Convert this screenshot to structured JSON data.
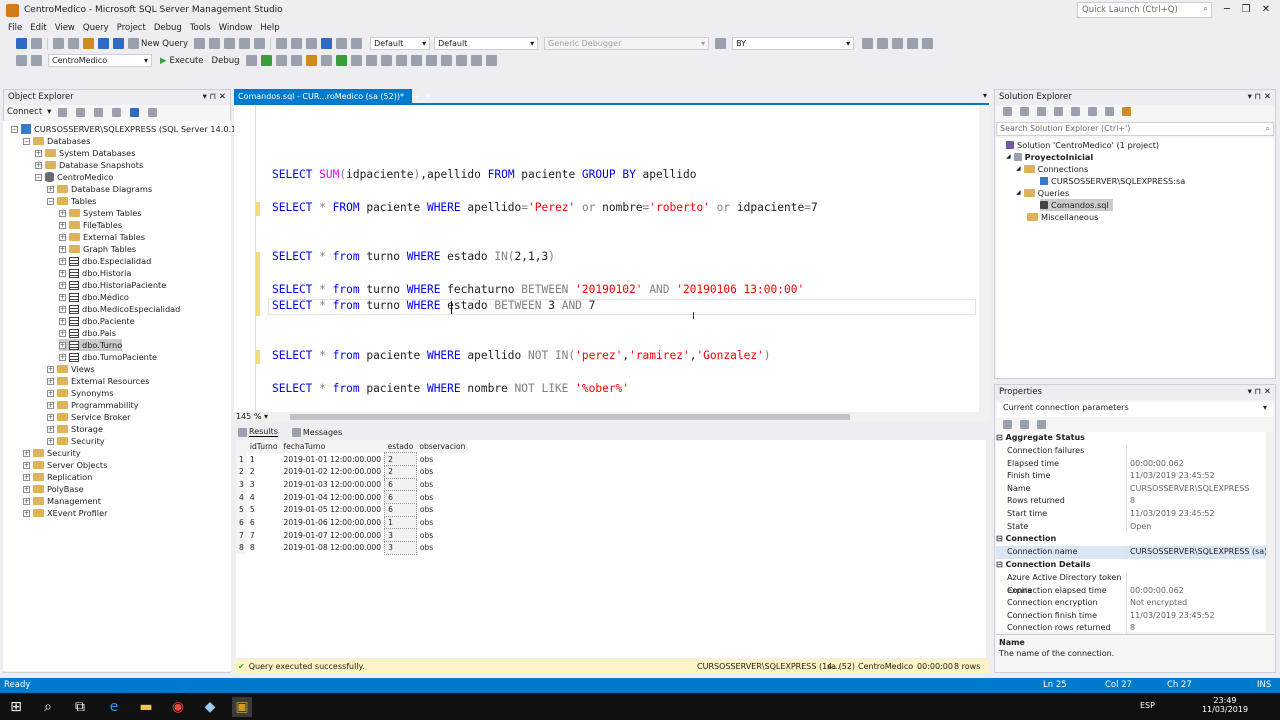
{
  "app": {
    "title": "CentroMedico - Microsoft SQL Server Management Studio",
    "quick_launch": "Quick Launch (Ctrl+Q)"
  },
  "menu": [
    "File",
    "Edit",
    "View",
    "Query",
    "Project",
    "Debug",
    "Tools",
    "Window",
    "Help"
  ],
  "toolbar1": {
    "new_query": "New Query",
    "config1": "Default",
    "config2": "Default",
    "debugger": "Generic Debugger",
    "find": "BY"
  },
  "toolbar2": {
    "database": "CentroMedico",
    "execute": "Execute",
    "debug": "Debug"
  },
  "object_explorer": {
    "title": "Object Explorer",
    "connect": "Connect",
    "nodes": [
      {
        "t": "CURSOSSERVER\\SQLEXPRESS (SQL Server 14.0.1000 - sa",
        "lvl": 0,
        "exp": "-",
        "ic": "srv"
      },
      {
        "t": "Databases",
        "lvl": 1,
        "exp": "-",
        "ic": "fold"
      },
      {
        "t": "System Databases",
        "lvl": 2,
        "exp": "+",
        "ic": "fold"
      },
      {
        "t": "Database Snapshots",
        "lvl": 2,
        "exp": "+",
        "ic": "fold"
      },
      {
        "t": "CentroMedico",
        "lvl": 2,
        "exp": "-",
        "ic": "db"
      },
      {
        "t": "Database Diagrams",
        "lvl": 3,
        "exp": "+",
        "ic": "fold"
      },
      {
        "t": "Tables",
        "lvl": 3,
        "exp": "-",
        "ic": "fold"
      },
      {
        "t": "System Tables",
        "lvl": 4,
        "exp": "+",
        "ic": "fold"
      },
      {
        "t": "FileTables",
        "lvl": 4,
        "exp": "+",
        "ic": "fold"
      },
      {
        "t": "External Tables",
        "lvl": 4,
        "exp": "+",
        "ic": "fold"
      },
      {
        "t": "Graph Tables",
        "lvl": 4,
        "exp": "+",
        "ic": "fold"
      },
      {
        "t": "dbo.Especialidad",
        "lvl": 4,
        "exp": "+",
        "ic": "tbl"
      },
      {
        "t": "dbo.Historia",
        "lvl": 4,
        "exp": "+",
        "ic": "tbl"
      },
      {
        "t": "dbo.HistoriaPaciente",
        "lvl": 4,
        "exp": "+",
        "ic": "tbl"
      },
      {
        "t": "dbo.Medico",
        "lvl": 4,
        "exp": "+",
        "ic": "tbl"
      },
      {
        "t": "dbo.MedicoEspecialidad",
        "lvl": 4,
        "exp": "+",
        "ic": "tbl"
      },
      {
        "t": "dbo.Paciente",
        "lvl": 4,
        "exp": "+",
        "ic": "tbl"
      },
      {
        "t": "dbo.Pais",
        "lvl": 4,
        "exp": "+",
        "ic": "tbl"
      },
      {
        "t": "dbo.Turno",
        "lvl": 4,
        "exp": "+",
        "ic": "tbl",
        "sel": true
      },
      {
        "t": "dbo.TurnoPaciente",
        "lvl": 4,
        "exp": "+",
        "ic": "tbl"
      },
      {
        "t": "Views",
        "lvl": 3,
        "exp": "+",
        "ic": "fold"
      },
      {
        "t": "External Resources",
        "lvl": 3,
        "exp": "+",
        "ic": "fold"
      },
      {
        "t": "Synonyms",
        "lvl": 3,
        "exp": "+",
        "ic": "fold"
      },
      {
        "t": "Programmability",
        "lvl": 3,
        "exp": "+",
        "ic": "fold"
      },
      {
        "t": "Service Broker",
        "lvl": 3,
        "exp": "+",
        "ic": "fold"
      },
      {
        "t": "Storage",
        "lvl": 3,
        "exp": "+",
        "ic": "fold"
      },
      {
        "t": "Security",
        "lvl": 3,
        "exp": "+",
        "ic": "fold"
      },
      {
        "t": "Security",
        "lvl": 1,
        "exp": "+",
        "ic": "fold"
      },
      {
        "t": "Server Objects",
        "lvl": 1,
        "exp": "+",
        "ic": "fold"
      },
      {
        "t": "Replication",
        "lvl": 1,
        "exp": "+",
        "ic": "fold"
      },
      {
        "t": "PolyBase",
        "lvl": 1,
        "exp": "+",
        "ic": "fold"
      },
      {
        "t": "Management",
        "lvl": 1,
        "exp": "+",
        "ic": "fold"
      },
      {
        "t": "XEvent Profiler",
        "lvl": 1,
        "exp": "+",
        "ic": "fold"
      }
    ]
  },
  "editor": {
    "tab": "Comandos.sql - CUR...roMedico (sa (52))*",
    "zoom": "145 %",
    "lines": [
      [
        [
          "kw",
          "SELECT "
        ],
        [
          "fn",
          "SUM"
        ],
        [
          "op",
          "("
        ],
        [
          "",
          "idpaciente"
        ],
        [
          "op",
          ")"
        ],
        [
          "",
          ","
        ],
        [
          "",
          "apellido "
        ],
        [
          "kw",
          "FROM "
        ],
        [
          "",
          "paciente "
        ],
        [
          "kw",
          "GROUP BY "
        ],
        [
          "",
          "apellido"
        ]
      ],
      [
        [
          "kw",
          "SELECT "
        ],
        [
          "op",
          "* "
        ],
        [
          "kw",
          "FROM "
        ],
        [
          "",
          "paciente "
        ],
        [
          "kw",
          "WHERE "
        ],
        [
          "",
          "apellido"
        ],
        [
          "op",
          "="
        ],
        [
          "str",
          "'Perez' "
        ],
        [
          "op",
          "or "
        ],
        [
          "",
          "nombre"
        ],
        [
          "op",
          "="
        ],
        [
          "str",
          "'roberto' "
        ],
        [
          "op",
          "or "
        ],
        [
          "",
          "idpaciente"
        ],
        [
          "op",
          "="
        ],
        [
          "",
          "7"
        ]
      ],
      [
        [
          "kw",
          "SELECT "
        ],
        [
          "op",
          "* "
        ],
        [
          "kw",
          "from "
        ],
        [
          "",
          "turno "
        ],
        [
          "kw",
          "WHERE "
        ],
        [
          "",
          "estado "
        ],
        [
          "op",
          "IN("
        ],
        [
          "",
          "2,1,3"
        ],
        [
          "op",
          ")"
        ]
      ],
      [
        [
          "kw",
          "SELECT "
        ],
        [
          "op",
          "* "
        ],
        [
          "kw",
          "from "
        ],
        [
          "",
          "turno "
        ],
        [
          "kw",
          "WHERE "
        ],
        [
          "",
          "fechaturno "
        ],
        [
          "op",
          "BETWEEN "
        ],
        [
          "str",
          "'20190102' "
        ],
        [
          "op",
          "AND "
        ],
        [
          "str",
          "'20190106 13:00:00'"
        ]
      ],
      [
        [
          "kw",
          "SELECT "
        ],
        [
          "op",
          "* "
        ],
        [
          "kw",
          "from "
        ],
        [
          "",
          "turno "
        ],
        [
          "kw",
          "WHERE "
        ],
        [
          "",
          "estado "
        ],
        [
          "op",
          "BETWEEN "
        ],
        [
          "",
          "3 "
        ],
        [
          "op",
          "AND "
        ],
        [
          "",
          "7"
        ]
      ],
      [
        [
          "kw",
          "SELECT "
        ],
        [
          "op",
          "* "
        ],
        [
          "kw",
          "from "
        ],
        [
          "",
          "paciente "
        ],
        [
          "kw",
          "WHERE "
        ],
        [
          "",
          "apellido "
        ],
        [
          "op",
          "NOT IN("
        ],
        [
          "str",
          "'perez'"
        ],
        [
          "",
          ","
        ],
        [
          "str",
          "'ramirez'"
        ],
        [
          "",
          ","
        ],
        [
          "str",
          "'Gonzalez'"
        ],
        [
          "op",
          ")"
        ]
      ],
      [
        [
          "kw",
          "SELECT "
        ],
        [
          "op",
          "* "
        ],
        [
          "kw",
          "from "
        ],
        [
          "",
          "paciente "
        ],
        [
          "kw",
          "WHERE "
        ],
        [
          "",
          "nombre "
        ],
        [
          "op",
          "NOT LIKE "
        ],
        [
          "str",
          "'%ober%'"
        ]
      ]
    ]
  },
  "results": {
    "tab_results": "Results",
    "tab_messages": "Messages",
    "columns": [
      "idTurno",
      "fechaTurno",
      "estado",
      "observacion"
    ],
    "rows": [
      [
        "1",
        "1",
        "2019-01-01 12:00:00.000",
        "2",
        "obs"
      ],
      [
        "2",
        "2",
        "2019-01-02 12:00:00.000",
        "2",
        "obs"
      ],
      [
        "3",
        "3",
        "2019-01-03 12:00:00.000",
        "6",
        "obs"
      ],
      [
        "4",
        "4",
        "2019-01-04 12:00:00.000",
        "6",
        "obs"
      ],
      [
        "5",
        "5",
        "2019-01-05 12:00:00.000",
        "6",
        "obs"
      ],
      [
        "6",
        "6",
        "2019-01-06 12:00:00.000",
        "1",
        "obs"
      ],
      [
        "7",
        "7",
        "2019-01-07 12:00:00.000",
        "3",
        "obs"
      ],
      [
        "8",
        "8",
        "2019-01-08 12:00:00.000",
        "3",
        "obs"
      ]
    ],
    "status": "Query executed successfully.",
    "server": "CURSOSSERVER\\SQLEXPRESS (14...",
    "user": "sa (52)",
    "db": "CentroMedico",
    "time": "00:00:00",
    "rows_count": "8 rows"
  },
  "solution": {
    "title": "Solution Explorer",
    "search": "Search Solution Explorer (Ctrl+')",
    "items": [
      "Solution 'CentroMedico' (1 project)",
      "ProyectoInicial",
      "Connections",
      "CURSOSSERVER\\SQLEXPRESS:sa",
      "Queries",
      "Comandos.sql",
      "Miscellaneous"
    ]
  },
  "properties": {
    "title": "Properties",
    "object": "Current connection parameters",
    "cat1": "Aggregate Status",
    "agg": [
      [
        "Connection failures",
        ""
      ],
      [
        "Elapsed time",
        "00:00:00.062"
      ],
      [
        "Finish time",
        "11/03/2019 23:45:52"
      ],
      [
        "Name",
        "CURSOSSERVER\\SQLEXPRESS"
      ],
      [
        "Rows returned",
        "8"
      ],
      [
        "Start time",
        "11/03/2019 23:45:52"
      ],
      [
        "State",
        "Open"
      ]
    ],
    "cat2": "Connection",
    "conn": [
      [
        "Connection name",
        "CURSOSSERVER\\SQLEXPRESS (sa)"
      ]
    ],
    "cat3": "Connection Details",
    "details": [
      [
        "Azure Active Directory token expira",
        ""
      ],
      [
        "Connection elapsed time",
        "00:00:00.062"
      ],
      [
        "Connection encryption",
        "Not encrypted"
      ],
      [
        "Connection finish time",
        "11/03/2019 23:45:52"
      ],
      [
        "Connection rows returned",
        "8"
      ]
    ],
    "desc_title": "Name",
    "desc": "The name of the connection."
  },
  "statusbar": {
    "ready": "Ready",
    "ln": "Ln 25",
    "col": "Col 27",
    "ch": "Ch 27",
    "ins": "INS"
  },
  "taskbar": {
    "time": "23:49",
    "date": "11/03/2019",
    "lang": "ESP"
  }
}
